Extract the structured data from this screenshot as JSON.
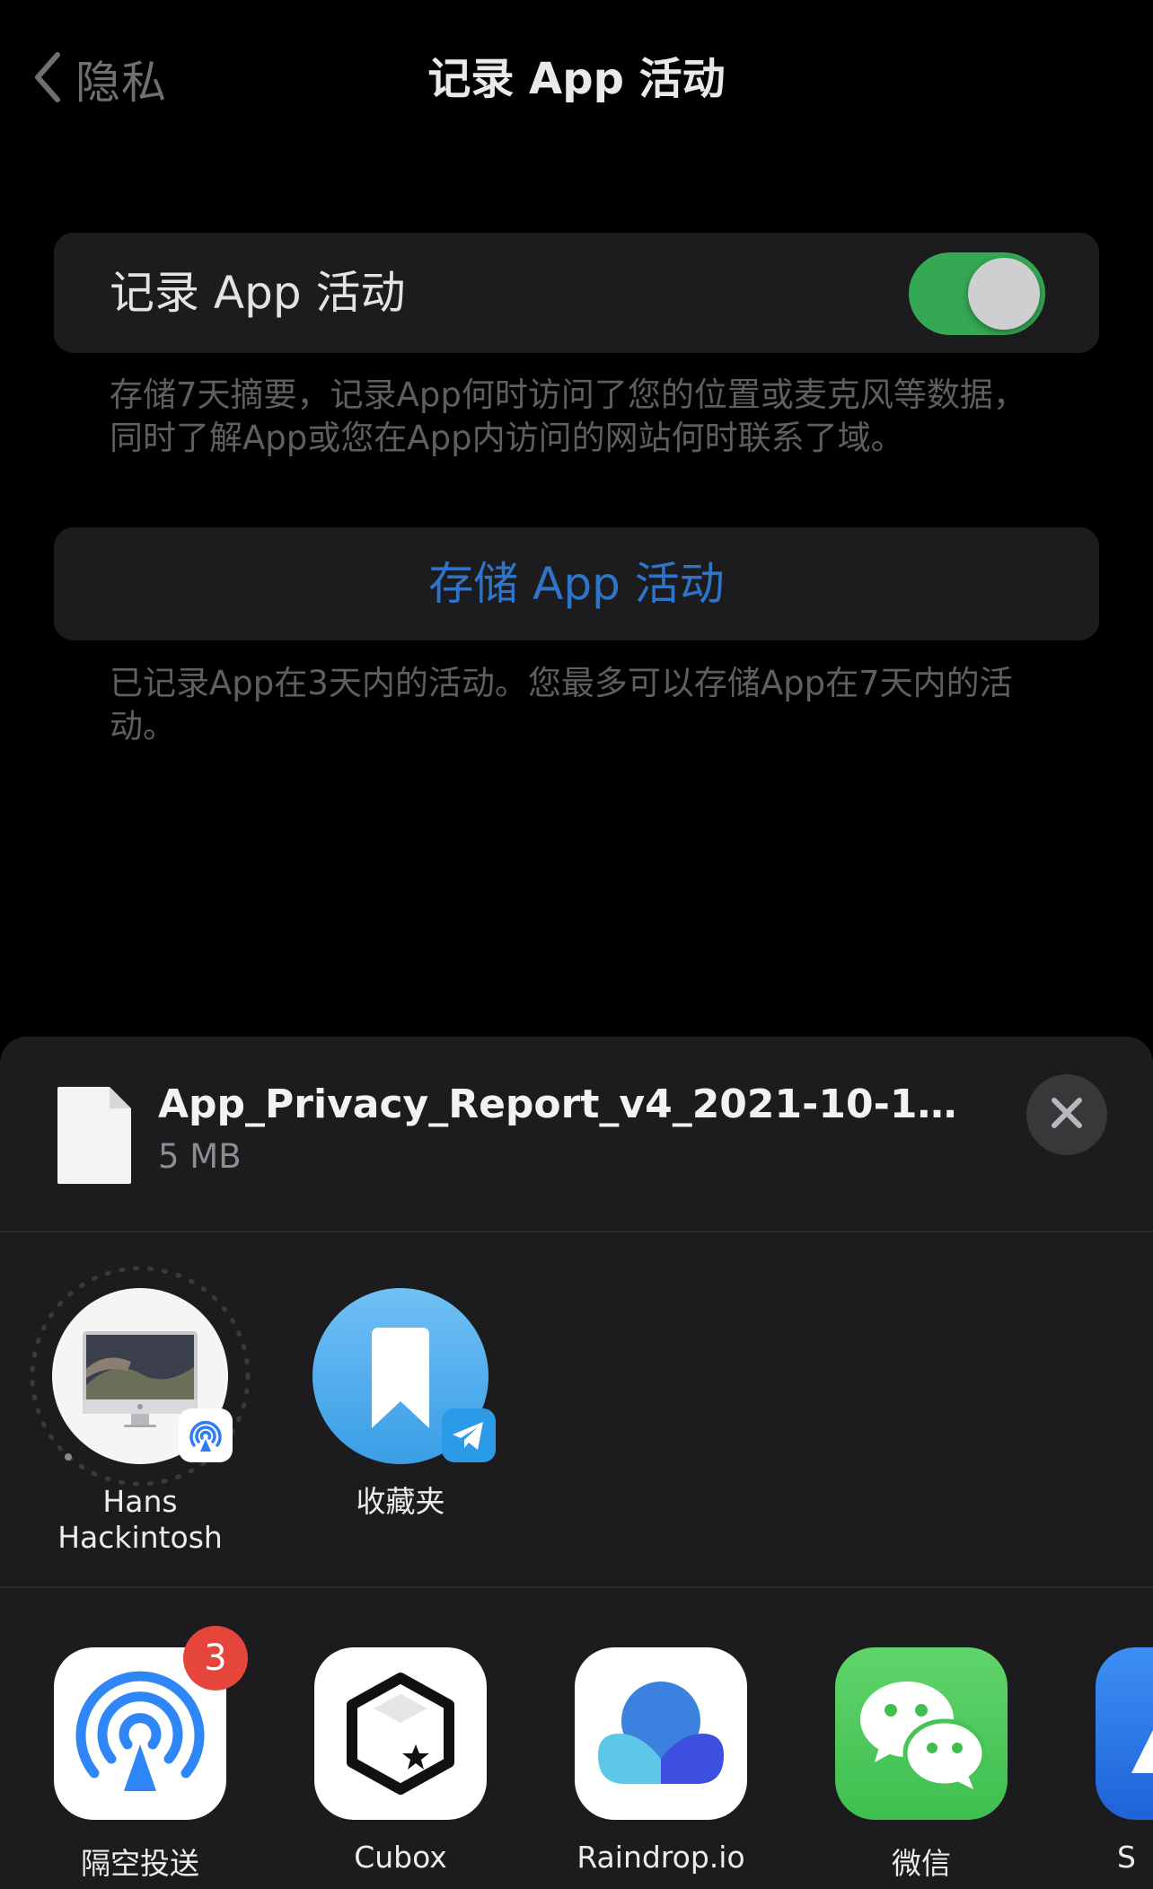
{
  "nav": {
    "back_label": "隐私",
    "title": "记录 App 活动"
  },
  "settings": {
    "record_label": "记录 App 活动",
    "record_enabled": true,
    "record_footnote": "存储7天摘要，记录App何时访问了您的位置或麦克风等数据，同时了解App或您在App内访问的网站何时联系了域。",
    "store_label": "存储 App 活动",
    "store_footnote": "已记录App在3天内的活动。您最多可以存储App在7天内的活动。"
  },
  "share_sheet": {
    "file_name": "App_Privacy_Report_v4_2021-10-11T23...",
    "file_size": "5 MB",
    "contacts": [
      {
        "name": "Hans Hackintosh",
        "icon": "imac-icon",
        "badge_icon": "airdrop-icon"
      },
      {
        "name": "收藏夹",
        "icon": "bookmark-icon",
        "badge_icon": "telegram-icon"
      }
    ],
    "apps": [
      {
        "name": "隔空投送",
        "icon": "airdrop-icon",
        "badge": "3"
      },
      {
        "name": "Cubox",
        "icon": "cubox-icon"
      },
      {
        "name": "Raindrop.io",
        "icon": "raindrop-icon"
      },
      {
        "name": "微信",
        "icon": "wechat-icon"
      },
      {
        "name": "S",
        "icon": "safari-like-icon"
      }
    ]
  },
  "colors": {
    "toggle_on": "#34a853",
    "link_blue": "#2f74c8",
    "sheet_bg": "#1c1c1e",
    "badge_red": "#e5453a"
  }
}
